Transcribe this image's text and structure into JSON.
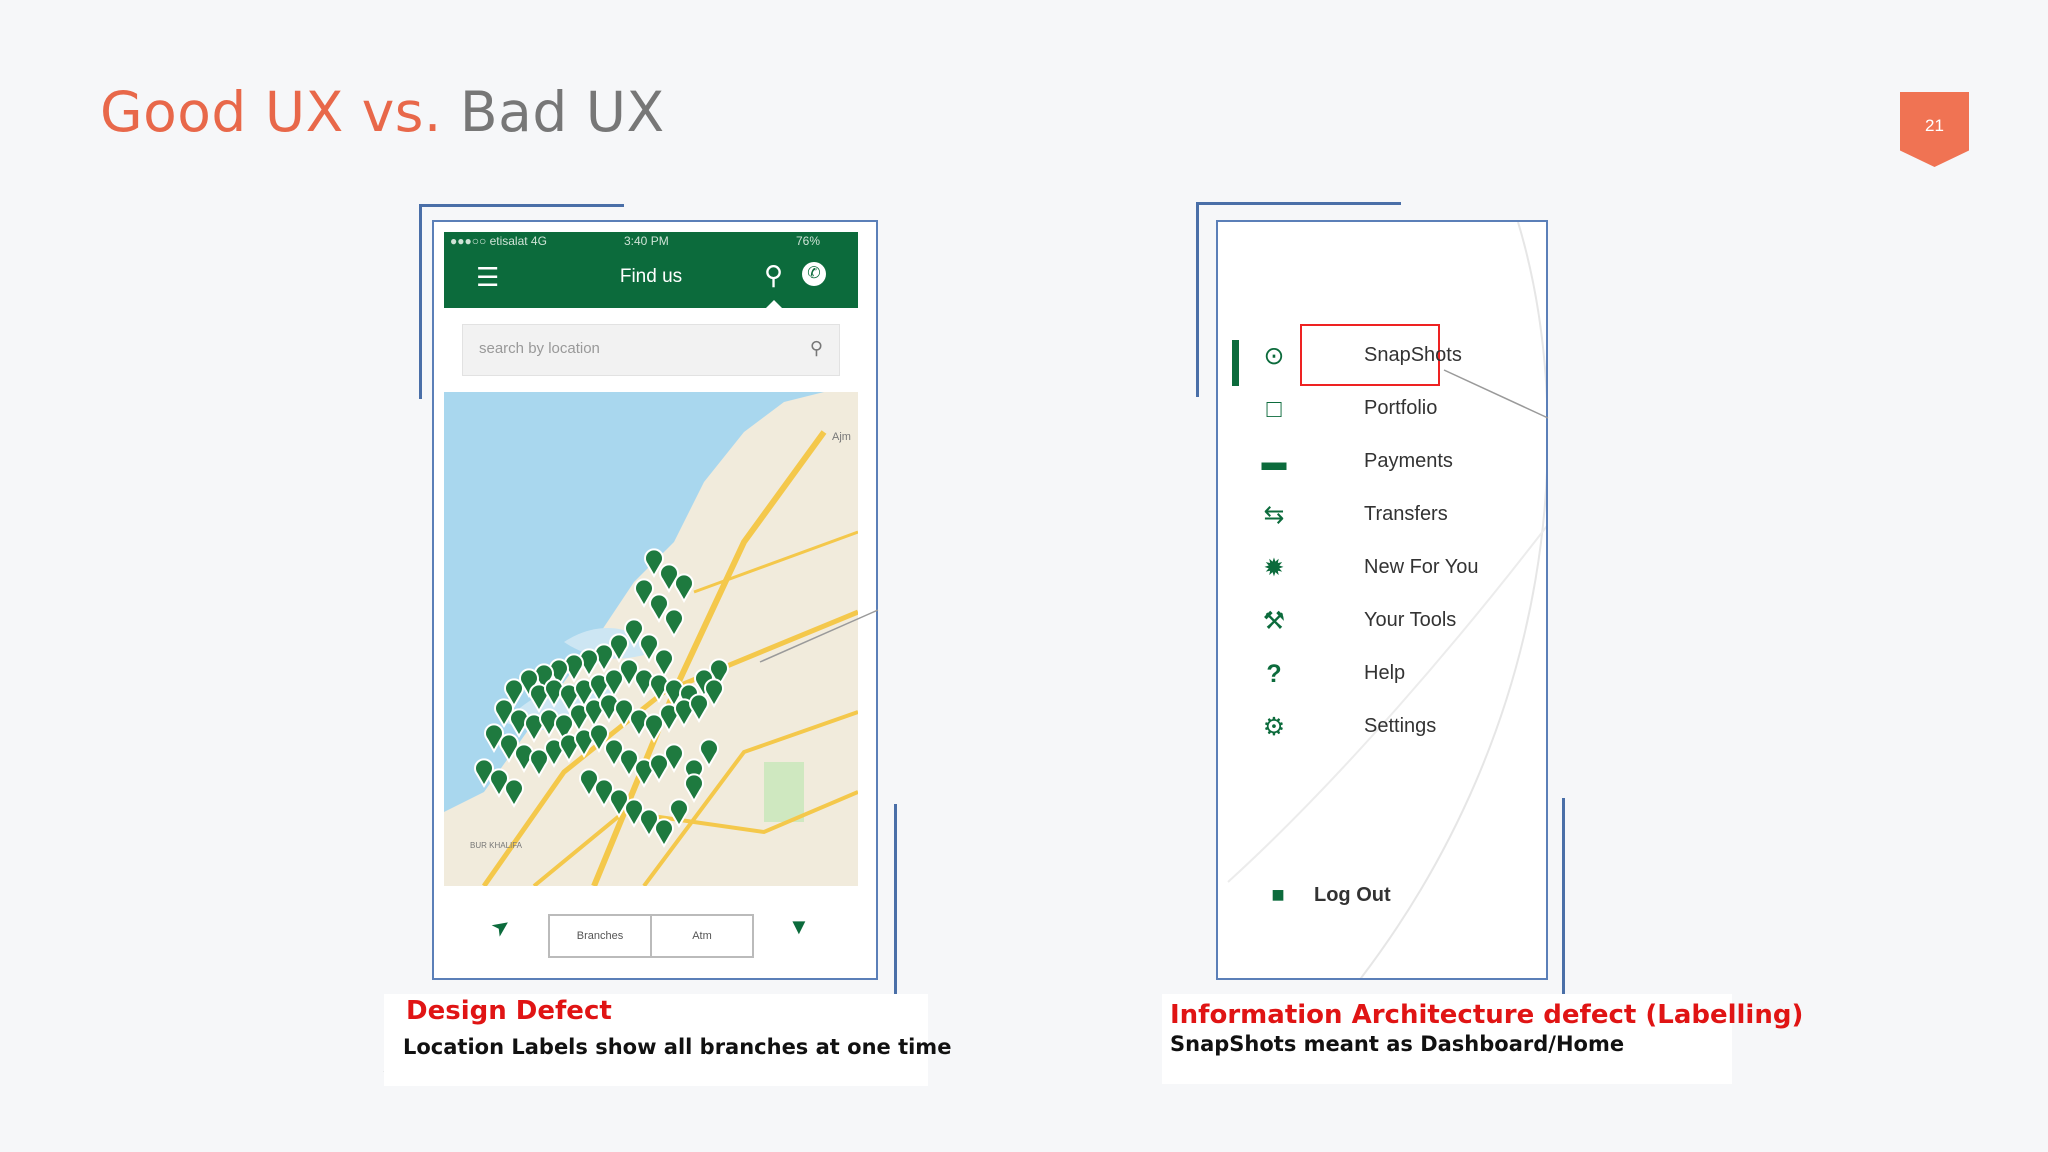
{
  "slide": {
    "title_good": "Good UX vs.",
    "title_bad": "Bad UX",
    "page_number": "21"
  },
  "colors": {
    "accent": "#e8684a",
    "brand_green": "#0c6b3c",
    "defect_red": "#e01414",
    "frame_blue": "#4a6fa8"
  },
  "left_phone": {
    "status_bar": {
      "carrier": "●●●○○ etisalat 4G",
      "time": "3:40 PM",
      "battery": "76%"
    },
    "app_bar": {
      "title": "Find us",
      "icons": [
        "menu-icon",
        "location-pin-icon",
        "phone-icon"
      ]
    },
    "search": {
      "placeholder": "search by location"
    },
    "map": {
      "labels": [
        "Ajm",
        "BUR KHALIFA"
      ]
    },
    "segments": [
      "Branches",
      "Atm"
    ],
    "bottom_icons": [
      "navigation-arrow-icon",
      "filter-icon"
    ]
  },
  "right_menu": {
    "items": [
      {
        "label": "SnapShots",
        "icon": "target-icon"
      },
      {
        "label": "Portfolio",
        "icon": "folder-icon"
      },
      {
        "label": "Payments",
        "icon": "cash-icon"
      },
      {
        "label": "Transfers",
        "icon": "transfer-arrows-icon"
      },
      {
        "label": "New For You",
        "icon": "badge-icon"
      },
      {
        "label": "Your Tools",
        "icon": "wrench-icon"
      },
      {
        "label": "Help",
        "icon": "question-icon"
      },
      {
        "label": "Settings",
        "icon": "gear-icon"
      }
    ],
    "logout": "Log Out"
  },
  "captions": {
    "left_title": "Design Defect",
    "left_subtitle": "Location Labels show all branches at one time",
    "right_title": "Information Architecture defect (Labelling)",
    "right_subtitle": "SnapShots meant as Dashboard/Home"
  }
}
